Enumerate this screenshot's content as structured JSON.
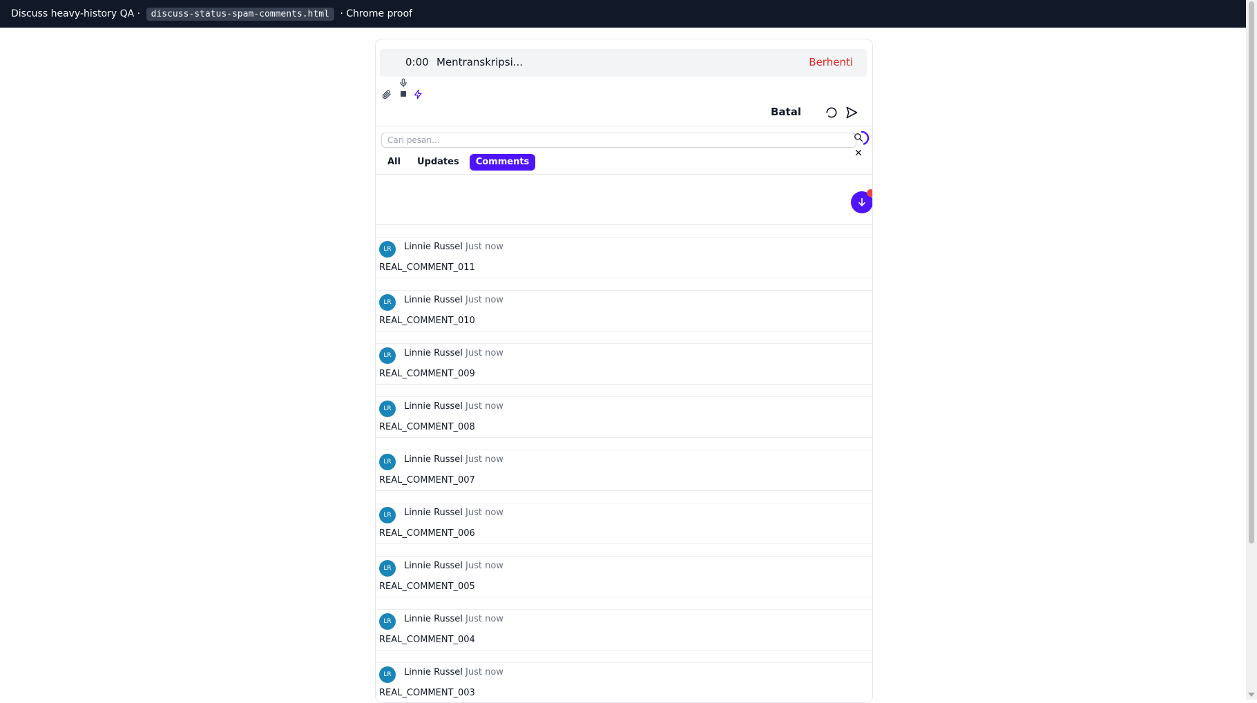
{
  "window": {
    "title_prefix": "Discuss heavy-history QA ·",
    "file": "discuss-status-spam-comments.html",
    "title_suffix": "· Chrome proof"
  },
  "recorder": {
    "time": "0:00",
    "status": "Mentranskripsi...",
    "stop_label": "Berhenti"
  },
  "composer": {
    "cancel_label": "Batal"
  },
  "search": {
    "placeholder": "Cari pesan..."
  },
  "tabs": [
    {
      "label": "All",
      "active": false
    },
    {
      "label": "Updates",
      "active": false
    },
    {
      "label": "Comments",
      "active": true
    }
  ],
  "comments": [
    {
      "initials": "LR",
      "author": "Linnie Russel",
      "time": "Just now",
      "text": "REAL_COMMENT_011"
    },
    {
      "initials": "LR",
      "author": "Linnie Russel",
      "time": "Just now",
      "text": "REAL_COMMENT_010"
    },
    {
      "initials": "LR",
      "author": "Linnie Russel",
      "time": "Just now",
      "text": "REAL_COMMENT_009"
    },
    {
      "initials": "LR",
      "author": "Linnie Russel",
      "time": "Just now",
      "text": "REAL_COMMENT_008"
    },
    {
      "initials": "LR",
      "author": "Linnie Russel",
      "time": "Just now",
      "text": "REAL_COMMENT_007"
    },
    {
      "initials": "LR",
      "author": "Linnie Russel",
      "time": "Just now",
      "text": "REAL_COMMENT_006"
    },
    {
      "initials": "LR",
      "author": "Linnie Russel",
      "time": "Just now",
      "text": "REAL_COMMENT_005"
    },
    {
      "initials": "LR",
      "author": "Linnie Russel",
      "time": "Just now",
      "text": "REAL_COMMENT_004"
    },
    {
      "initials": "LR",
      "author": "Linnie Russel",
      "time": "Just now",
      "text": "REAL_COMMENT_003"
    }
  ],
  "colors": {
    "accent": "#4f14ff",
    "danger": "#dc2626",
    "avatar": "#1a86b8",
    "topbar": "#111827"
  },
  "icons": [
    "paperclip-icon",
    "mic-icon",
    "stop-icon",
    "bolt-icon",
    "undo-icon",
    "send-icon",
    "search-icon",
    "spinner-icon",
    "close-icon",
    "arrow-down-icon"
  ]
}
